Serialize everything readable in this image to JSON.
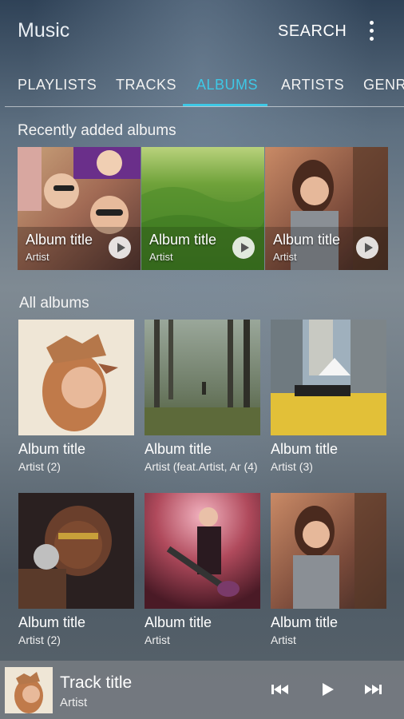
{
  "app": {
    "title": "Music"
  },
  "toolbar": {
    "search_label": "SEARCH",
    "more_icon": "more-vert-icon"
  },
  "tabs": [
    {
      "label": "PLAYLISTS",
      "active": false
    },
    {
      "label": "TRACKS",
      "active": false
    },
    {
      "label": "ALBUMS",
      "active": true
    },
    {
      "label": "ARTISTS",
      "active": false
    },
    {
      "label": "GENRE",
      "active": false
    }
  ],
  "colors": {
    "accent": "#3ec8e6"
  },
  "recent": {
    "heading": "Recently added albums",
    "items": [
      {
        "title": "Album title",
        "artist": "Artist"
      },
      {
        "title": "Album title",
        "artist": "Artist"
      },
      {
        "title": "Album title",
        "artist": "Artist"
      }
    ]
  },
  "all": {
    "heading": "All albums",
    "items": [
      {
        "title": "Album title",
        "artist": "Artist (2)"
      },
      {
        "title": "Album title",
        "artist": "Artist (feat.Artist, Ar (4)"
      },
      {
        "title": "Album title",
        "artist": "Artist (3)"
      },
      {
        "title": "Album title",
        "artist": "Artist (2)"
      },
      {
        "title": "Album title",
        "artist": "Artist"
      },
      {
        "title": "Album title",
        "artist": "Artist"
      }
    ]
  },
  "player": {
    "track_title": "Track title",
    "artist": "Artist",
    "controls": [
      "previous-icon",
      "play-icon",
      "next-icon"
    ]
  }
}
